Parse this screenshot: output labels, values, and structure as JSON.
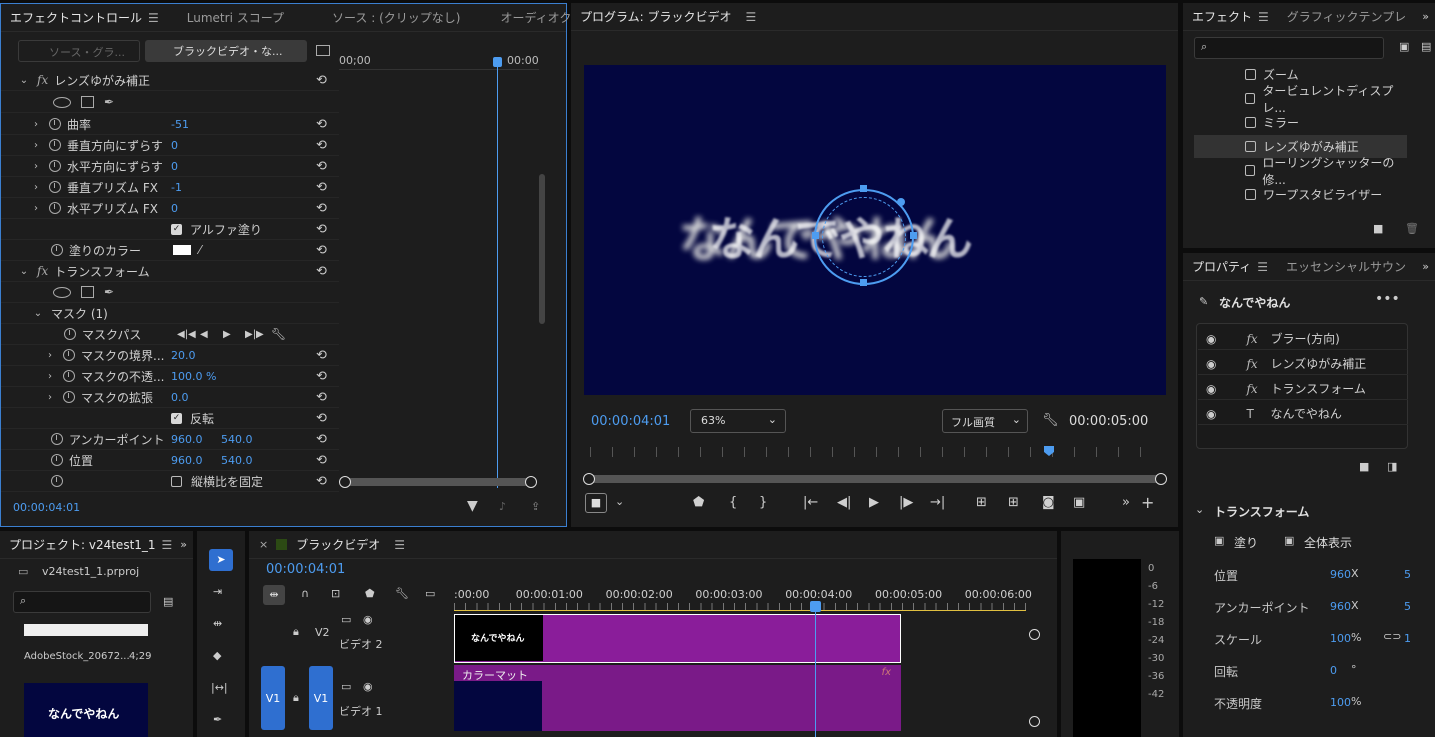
{
  "effect_controls": {
    "tabs": [
      "エフェクトコントロール",
      "Lumetri スコープ",
      "ソース : (クリップなし)",
      "オーディオク"
    ],
    "source_btn": "ソース・グラ...",
    "clip_btn": "ブラックビデオ・な...",
    "ruler": [
      "00;00",
      "00:00"
    ],
    "lens_title": "レンズゆがみ補正",
    "params": [
      {
        "label": "曲率",
        "value": "-51"
      },
      {
        "label": "垂直方向にずらす",
        "value": "0"
      },
      {
        "label": "水平方向にずらす",
        "value": "0"
      },
      {
        "label": "垂直プリズム FX",
        "value": "-1"
      },
      {
        "label": "水平プリズム FX",
        "value": "0"
      }
    ],
    "alpha_fill": "アルファ塗り",
    "fill_color": "塗りのカラー",
    "transform_title": "トランスフォーム",
    "mask_title": "マスク (1)",
    "mask_path": "マスクパス",
    "mask_params": [
      {
        "label": "マスクの境界...",
        "value": "20.0"
      },
      {
        "label": "マスクの不透...",
        "value": "100.0 %"
      },
      {
        "label": "マスクの拡張",
        "value": "0.0"
      }
    ],
    "invert": "反転",
    "anchor": {
      "label": "アンカーポイント",
      "x": "960.0",
      "y": "540.0"
    },
    "position": {
      "label": "位置",
      "x": "960.0",
      "y": "540.0"
    },
    "uniform": "縦横比を固定",
    "timecode": "00:00:04:01"
  },
  "program": {
    "title": "プログラム: ブラックビデオ",
    "overlay_text": "なんでやねん",
    "timecode": "00:00:04:01",
    "zoom": "63%",
    "quality": "フル画質",
    "duration": "00:00:05:00"
  },
  "effects": {
    "tabs": [
      "エフェクト",
      "グラフィックテンプレ"
    ],
    "items": [
      "ズーム",
      "タービュレントディスプレ...",
      "ミラー",
      "レンズゆがみ補正",
      "ローリングシャッターの修...",
      "ワープスタビライザー"
    ]
  },
  "properties": {
    "tabs": [
      "プロパティ",
      "エッセンシャルサウン"
    ],
    "clip": "なんでやねん",
    "layers": [
      "ブラー(方向)",
      "レンズゆがみ補正",
      "トランスフォーム",
      "なんでやねん"
    ],
    "transform": "トランスフォーム",
    "fill": "塗り",
    "fit": "全体表示",
    "rows": [
      {
        "label": "位置",
        "v1": "960",
        "u1": "X",
        "v2": "5"
      },
      {
        "label": "アンカーポイント",
        "v1": "960",
        "u1": "X",
        "v2": "5"
      },
      {
        "label": "スケール",
        "v1": "100",
        "u1": "%",
        "v2": "1"
      },
      {
        "label": "回転",
        "v1": "0",
        "u1": "°",
        "v2": ""
      },
      {
        "label": "不透明度",
        "v1": "100",
        "u1": "%",
        "v2": ""
      }
    ]
  },
  "project": {
    "title": "プロジェクト: v24test1_1",
    "file": "v24test1_1.prproj",
    "clip_name": "AdobeStock_20672...",
    "clip_dur": "4;29",
    "thumb_text": "なんでやねん"
  },
  "timeline": {
    "title": "ブラックビデオ",
    "timecode": "00:00:04:01",
    "ruler": [
      ":00:00",
      "00:00:01:00",
      "00:00:02:00",
      "00:00:03:00",
      "00:00:04:00",
      "00:00:05:00",
      "00:00:06:00"
    ],
    "v2": "V2",
    "v2_name": "ビデオ 2",
    "v1": "V1",
    "v1_name": "ビデオ 1",
    "clip1_text": "なんでやねん",
    "clip2_label": "カラーマット",
    "fx": "fx"
  },
  "meter": {
    "labels": [
      "0",
      "-6",
      "-12",
      "-18",
      "-24",
      "-30",
      "-36",
      "-42"
    ]
  }
}
